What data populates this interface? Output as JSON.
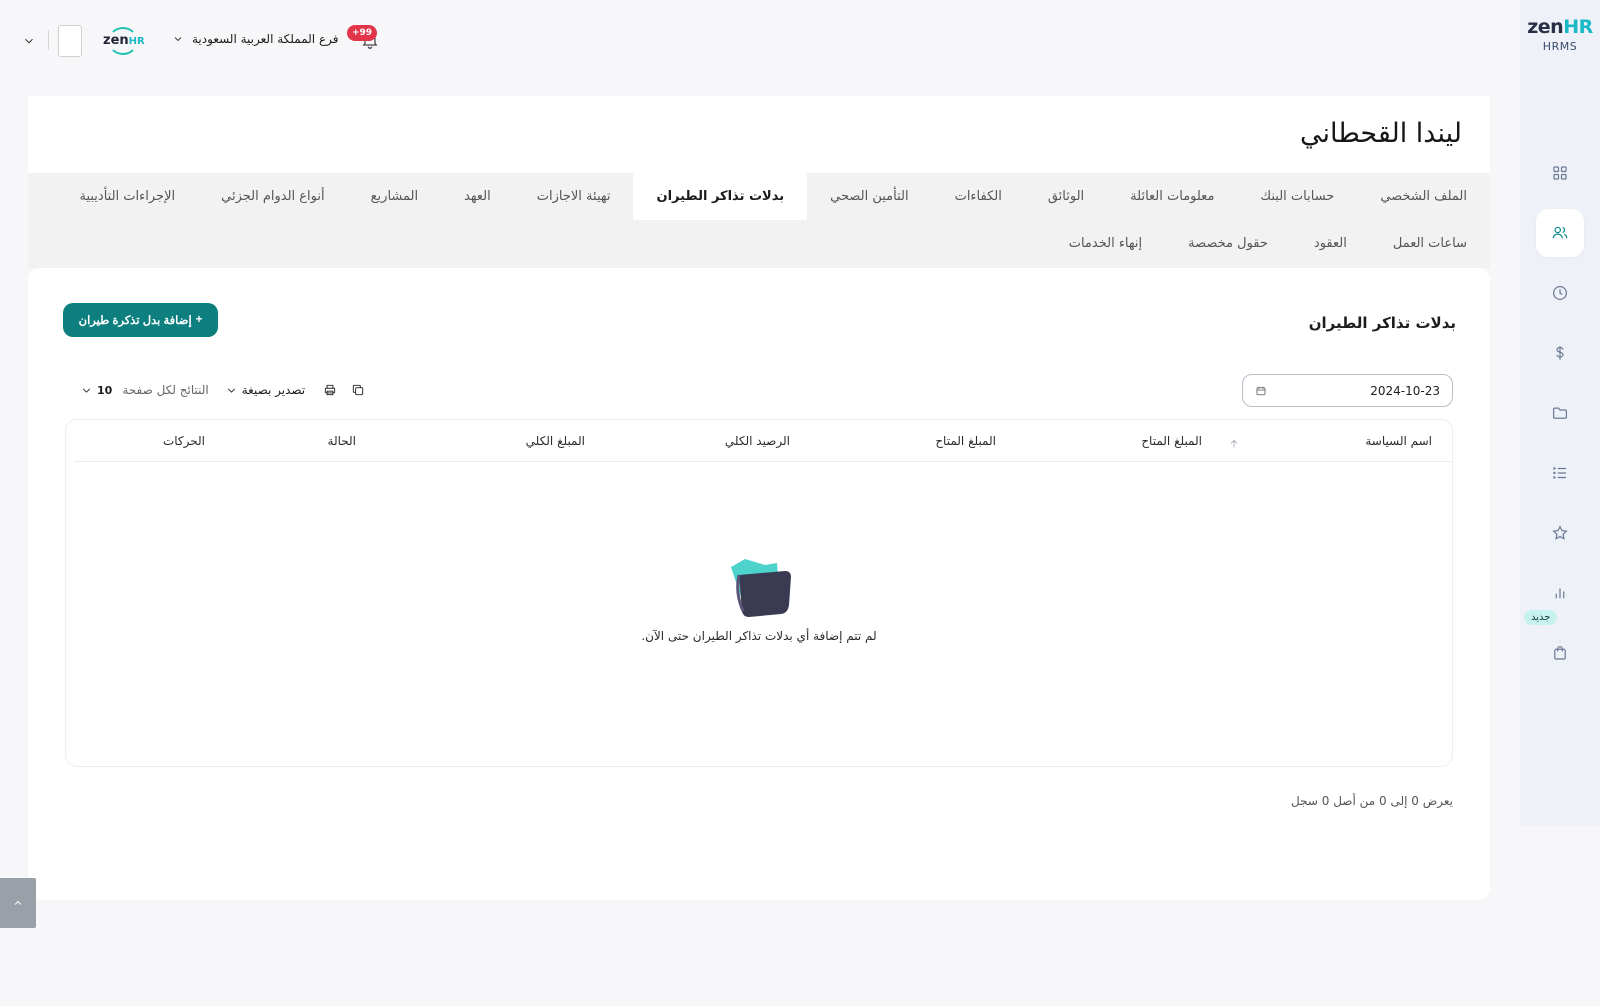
{
  "app": {
    "logo_main": "zen",
    "logo_accent": "HR",
    "logo_sub": "HRMS",
    "mini_logo_main": "zen",
    "mini_logo_accent": "HR",
    "accent_color": "#0e7f7f"
  },
  "sidebar": {
    "items": [
      {
        "icon": "grid-icon"
      },
      {
        "icon": "users-icon",
        "active": true
      },
      {
        "icon": "clock-icon"
      },
      {
        "icon": "dollar-icon"
      },
      {
        "icon": "folder-icon"
      },
      {
        "icon": "list-icon"
      },
      {
        "icon": "star-icon"
      },
      {
        "icon": "bar-chart-icon"
      },
      {
        "icon": "shopping-bag-icon",
        "badge": "جديد"
      }
    ]
  },
  "header": {
    "branch_label": "فرع المملكة العربية السعودية",
    "notifications_badge": "+99"
  },
  "employee": {
    "name": "ليندا القحطاني"
  },
  "tabs": {
    "row1": [
      "الملف الشخصي",
      "حسابات البنك",
      "معلومات العائلة",
      "الوثائق",
      "الكفاءات",
      "التأمين الصحي",
      "بدلات تذاكر الطيران",
      "تهيئة الاجازات",
      "العهد",
      "المشاريع",
      "أنواع الدوام الجزئي",
      "الإجراءات التأديبية"
    ],
    "row2": [
      "ساعات العمل",
      "العقود",
      "حقول مخصصة",
      "إنهاء الخدمات"
    ],
    "active": "بدلات تذاكر الطيران"
  },
  "section": {
    "title": "بدلات تذاكر الطيران",
    "add_button": "إضافة بدل تذكرة طيران",
    "add_button_icon": "+"
  },
  "filters": {
    "date_value": "2024-10-23"
  },
  "toolbar": {
    "per_page_value": "10",
    "per_page_label": "النتائج لكل صفحة",
    "export_label": "تصدير بصيغة"
  },
  "table": {
    "columns": [
      "اسم السياسة",
      "المبلغ المتاح",
      "المبلغ المتاح",
      "الرصيد الكلي",
      "المبلغ الكلي",
      "الحالة",
      "الحركات"
    ],
    "empty_message": "لم تتم إضافة أي بدلات تذاكر الطيران حتى الآن."
  },
  "pagination": {
    "summary": "يعرض 0 إلى 0 من أصل 0 سجل"
  }
}
